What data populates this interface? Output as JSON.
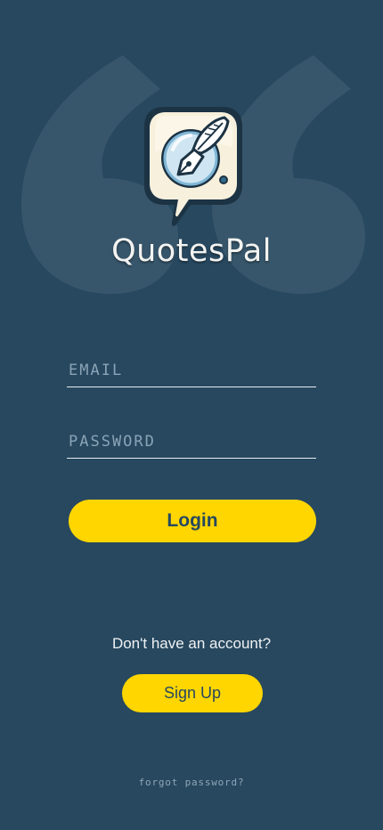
{
  "app": {
    "title": "QuotesPal"
  },
  "logo": {
    "icon": "quill-speech-bubble-icon"
  },
  "background": {
    "icon": "quotation-mark-icon"
  },
  "form": {
    "email": {
      "value": "",
      "placeholder": "EMAIL"
    },
    "password": {
      "value": "",
      "placeholder": "PASSWORD"
    },
    "login_label": "Login"
  },
  "signup": {
    "prompt": "Don't have an account?",
    "button_label": "Sign Up"
  },
  "forgot": {
    "label": "forgot password?"
  },
  "colors": {
    "background": "#27485f",
    "accent": "#ffd600",
    "text_light": "#f3f3f1",
    "placeholder": "#8aa4b6"
  }
}
